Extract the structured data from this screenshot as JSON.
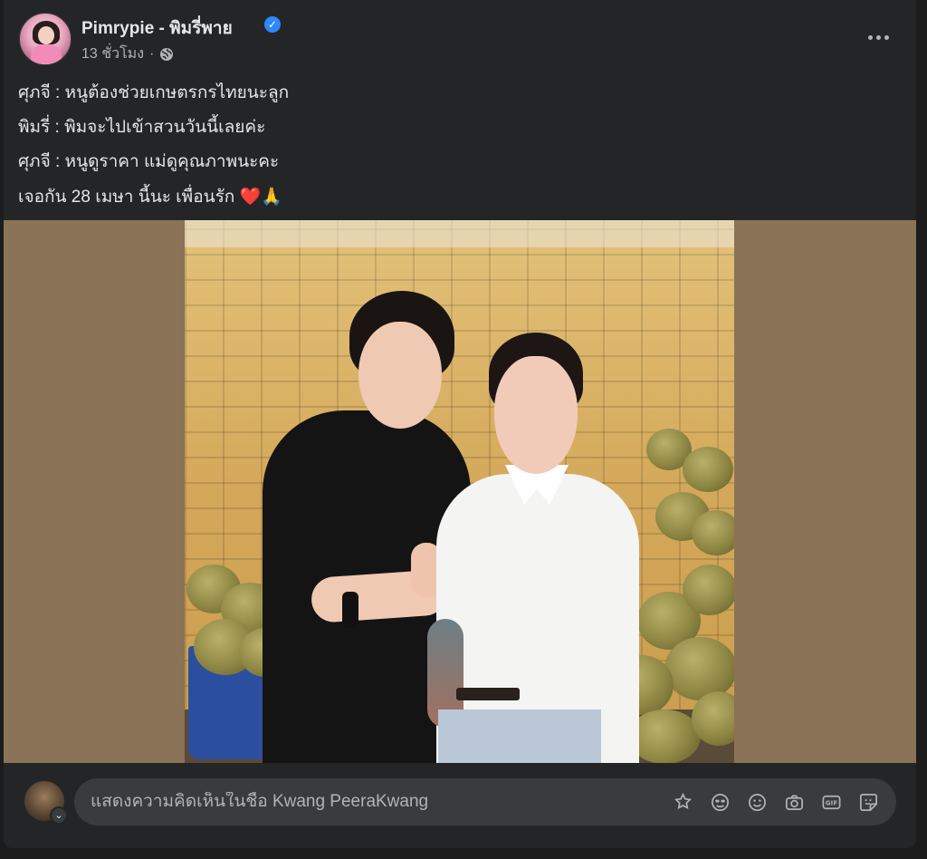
{
  "post": {
    "author_name": "Pimrypie - พิมรี่พาย",
    "time_ago": "13 ชั่วโมง",
    "separator": "·",
    "privacy_icon": "globe-icon",
    "more_icon": "more-options-icon",
    "lines": [
      "ศุภจี : หนูต้องช่วยเกษตรกรไทยนะลูก",
      "พิมรี่ : พิมจะไปเข้าสวนวันนี้เลยค่ะ",
      "ศุภจี : หนูดูราคา แม่ดูคุณภาพนะคะ",
      "เจอกัน 28 เมษา นี้นะ เพื่อนรัก"
    ],
    "emojis": {
      "heart": "❤️",
      "pray": "🙏"
    },
    "colors": {
      "background": "#242526",
      "text": "#e4e6eb",
      "secondary": "#b0b3b8",
      "verified": "#2d88ff",
      "media_frame": "#8a7356"
    }
  },
  "comment": {
    "placeholder": "แสดงความคิดเห็นในชื่อ Kwang PeeraKwang",
    "tools": [
      "avatar-sticker-icon",
      "emoji-smile-glasses-icon",
      "emoji-smile-icon",
      "camera-icon",
      "gif-icon",
      "sticker-icon"
    ],
    "gif_label": "GIF"
  }
}
